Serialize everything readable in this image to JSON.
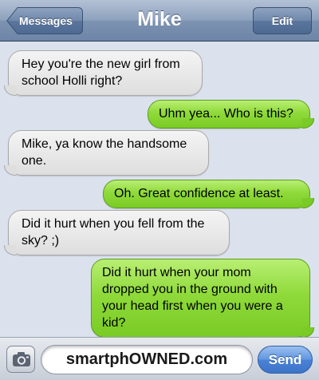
{
  "nav": {
    "back_label": "Messages",
    "title": "Mike",
    "edit_label": "Edit"
  },
  "messages": [
    {
      "direction": "incoming",
      "text": "Hey you're the new girl from school Holli right?"
    },
    {
      "direction": "outgoing",
      "text": "Uhm yea... Who is this?"
    },
    {
      "direction": "incoming",
      "text": "Mike, ya know the handsome one."
    },
    {
      "direction": "outgoing",
      "text": "Oh. Great confidence at least."
    },
    {
      "direction": "incoming",
      "text": "Did it hurt when you fell from the sky? ;)"
    },
    {
      "direction": "outgoing",
      "text": "Did it hurt when your mom dropped you in the ground with your head first when you were a kid?"
    }
  ],
  "composer": {
    "input_text": "smartphOWNED.com",
    "camera_icon": "camera-icon",
    "send_label": "Send"
  },
  "colors": {
    "incoming_bubble": "#e6e6e6",
    "outgoing_bubble": "#8fda3a",
    "nav_bar": "#8da1bd",
    "send_button": "#4a82d6"
  }
}
